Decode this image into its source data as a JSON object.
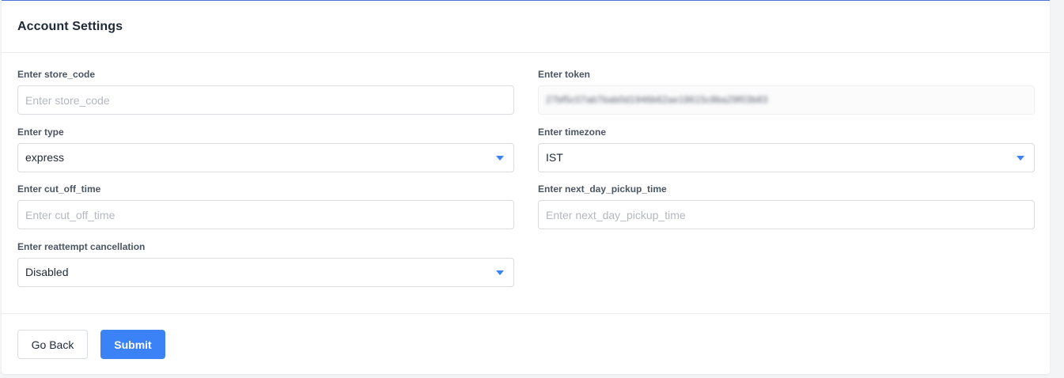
{
  "header": {
    "title": "Account Settings"
  },
  "form": {
    "store_code": {
      "label": "Enter store_code",
      "placeholder": "Enter store_code",
      "value": ""
    },
    "token": {
      "label": "Enter token",
      "value": "27bf5c07ab7bab0d1946b62ae18615c8ba29f03b83"
    },
    "type": {
      "label": "Enter type",
      "value": "express"
    },
    "timezone": {
      "label": "Enter timezone",
      "value": "IST"
    },
    "cut_off_time": {
      "label": "Enter cut_off_time",
      "placeholder": "Enter cut_off_time",
      "value": ""
    },
    "next_day_pickup_time": {
      "label": "Enter next_day_pickup_time",
      "placeholder": "Enter next_day_pickup_time",
      "value": ""
    },
    "reattempt_cancellation": {
      "label": "Enter reattempt cancellation",
      "value": "Disabled"
    }
  },
  "footer": {
    "back_label": "Go Back",
    "submit_label": "Submit"
  },
  "colors": {
    "accent": "#3b82f6",
    "top_border": "#4f70d8",
    "label_text": "#4b5563",
    "placeholder_text": "#b4b8bf"
  },
  "icons": {
    "select_caret": "caret-down-icon"
  }
}
